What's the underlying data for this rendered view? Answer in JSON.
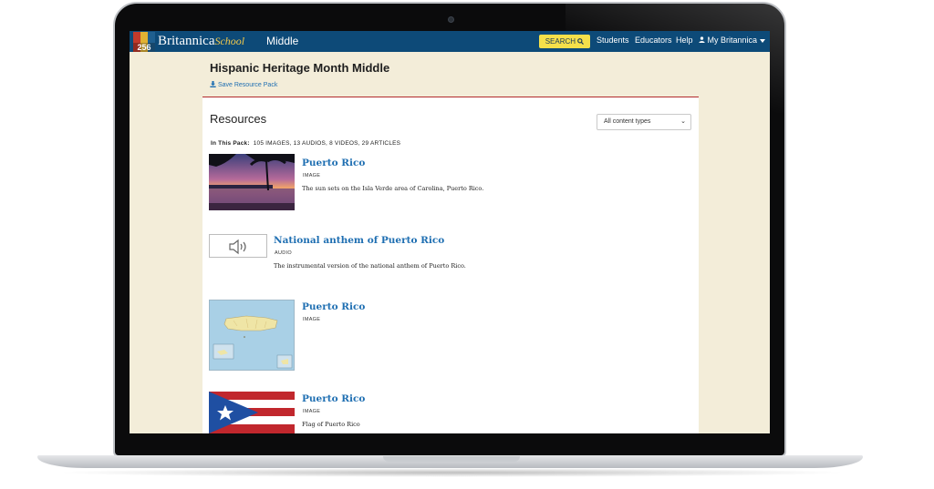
{
  "header": {
    "logo_number": "256",
    "brand_name": "Britannica",
    "brand_school": "School",
    "level": "Middle",
    "search_label": "SEARCH",
    "nav": [
      "Students",
      "Educators",
      "Help"
    ],
    "account_label": "My Britannica"
  },
  "page": {
    "title": "Hispanic Heritage Month Middle",
    "save_link": "Save Resource Pack"
  },
  "resources": {
    "heading": "Resources",
    "filter_selected": "All content types",
    "summary_label": "In This Pack:",
    "summary_text": "105 IMAGES, 13 AUDIOS, 8 VIDEOS, 29 ARTICLES",
    "items": [
      {
        "title": "Puerto Rico",
        "type": "IMAGE",
        "description": "The sun sets on the Isla Verde area of Carolina, Puerto Rico.",
        "thumb": "sunset-photo"
      },
      {
        "title": "National anthem of Puerto Rico",
        "type": "AUDIO",
        "description": "The instrumental version of the national anthem of Puerto Rico.",
        "thumb": "speaker-icon"
      },
      {
        "title": "Puerto Rico",
        "type": "IMAGE",
        "description": "",
        "thumb": "map"
      },
      {
        "title": "Puerto Rico",
        "type": "IMAGE",
        "description": "Flag of Puerto Rico",
        "thumb": "flag"
      }
    ]
  },
  "colors": {
    "header_bg": "#0d4a78",
    "page_bg": "#f3edd9",
    "link": "#1f6fb2",
    "search_bg": "#f5e04a",
    "divider": "#b22a2a"
  }
}
